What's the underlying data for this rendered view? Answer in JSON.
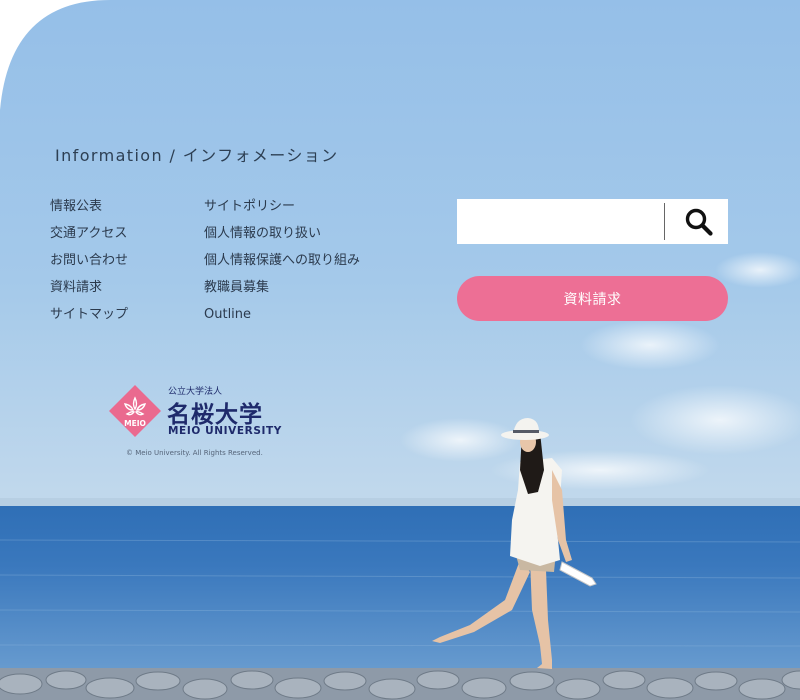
{
  "heading": "Information / インフォメーション",
  "links_left": [
    "情報公表",
    "交通アクセス",
    "お問い合わせ",
    "資料請求",
    "サイトマップ"
  ],
  "links_right": [
    "サイトポリシー",
    "個人情報の取り扱い",
    "個人情報保護への取り組み",
    "教職員募集",
    "Outline"
  ],
  "search": {
    "value": "",
    "placeholder": "",
    "icon": "search-icon"
  },
  "request_button_label": "資料請求",
  "logo": {
    "sub_label": "公立大学法人",
    "name": "名桜大学",
    "english_name": "MEIO UNIVERSITY",
    "emblem_text": "MEIO"
  },
  "copyright": "© Meio University. All Rights Reserved.",
  "colors": {
    "accent_pink": "#ed6f95",
    "logo_navy": "#1e2a6b",
    "sky": "#9cc3e8",
    "sea": "#3f79bb"
  }
}
